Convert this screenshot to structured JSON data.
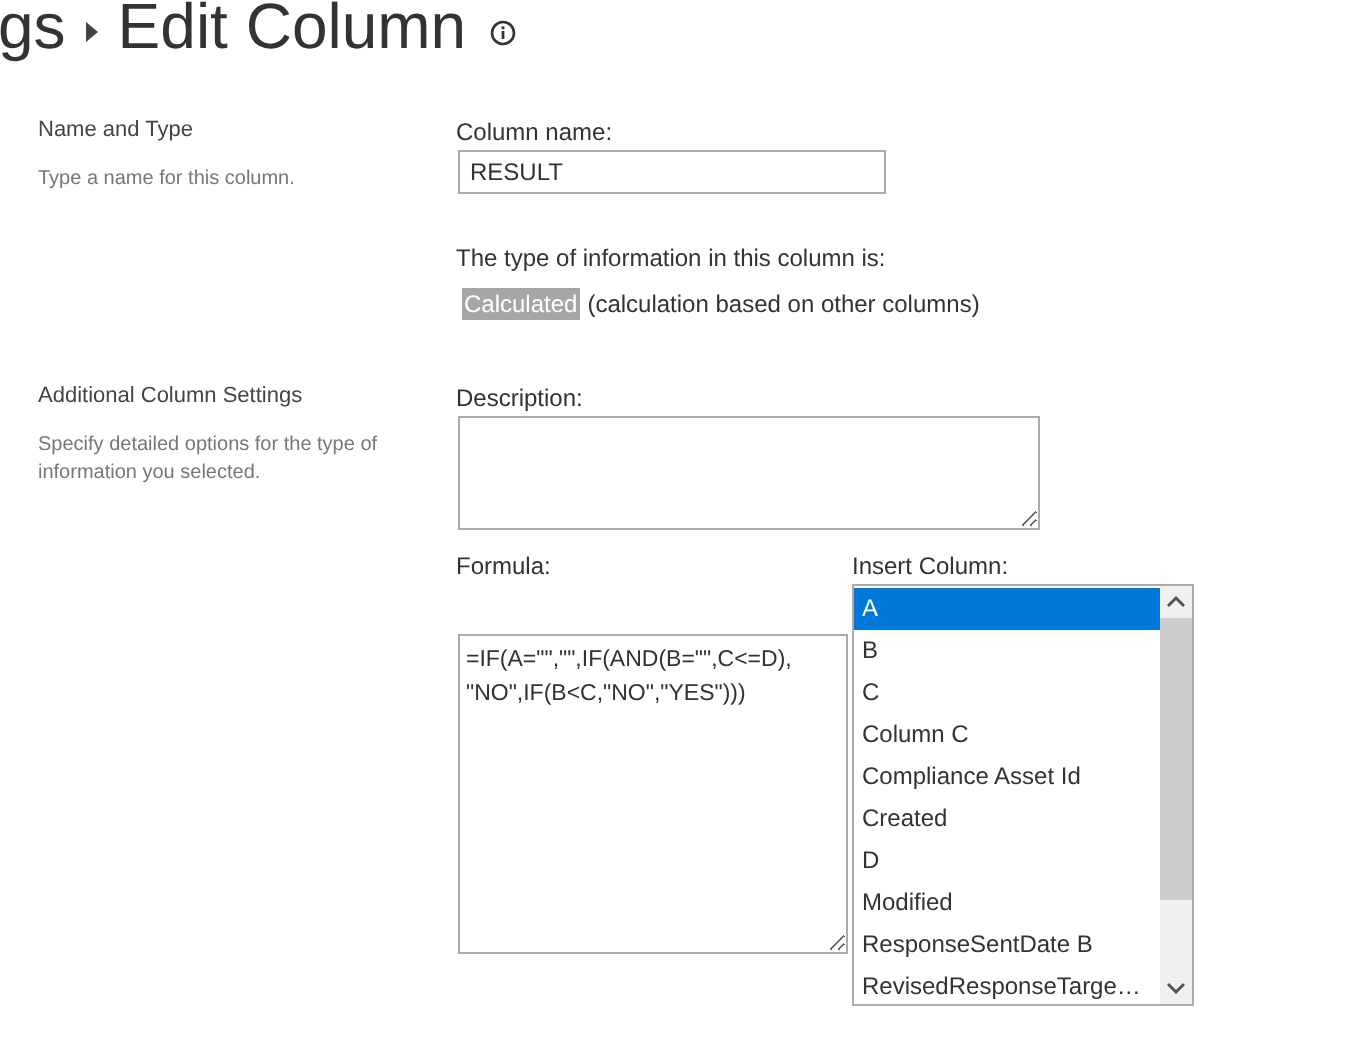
{
  "breadcrumb": {
    "parent": "gs",
    "current": "Edit Column"
  },
  "sections": [
    {
      "title": "Name and Type",
      "help": "Type a name for this column."
    },
    {
      "title": "Additional Column Settings",
      "help": "Specify detailed options for the type of information you selected."
    }
  ],
  "column_name": {
    "label": "Column name:",
    "value": "RESULT"
  },
  "type_info": {
    "label": "The type of information in this column is:",
    "value": "Calculated",
    "note": "(calculation based on other columns)"
  },
  "description": {
    "label": "Description:"
  },
  "formula": {
    "label": "Formula:",
    "value": "=IF(A=\"\",\"\",IF(AND(B=\"\",C<=D),\n\"NO\",IF(B<C,\"NO\",\"YES\")))"
  },
  "insert_column": {
    "label": "Insert Column:",
    "items": [
      {
        "label": "A",
        "selected": true
      },
      {
        "label": "B",
        "selected": false
      },
      {
        "label": "C",
        "selected": false
      },
      {
        "label": "Column C",
        "selected": false
      },
      {
        "label": "Compliance Asset Id",
        "selected": false
      },
      {
        "label": "Created",
        "selected": false
      },
      {
        "label": "D",
        "selected": false
      },
      {
        "label": "Modified",
        "selected": false
      },
      {
        "label": "ResponseSentDate B",
        "selected": false
      },
      {
        "label": "RevisedResponseTarge…",
        "selected": false
      }
    ]
  }
}
